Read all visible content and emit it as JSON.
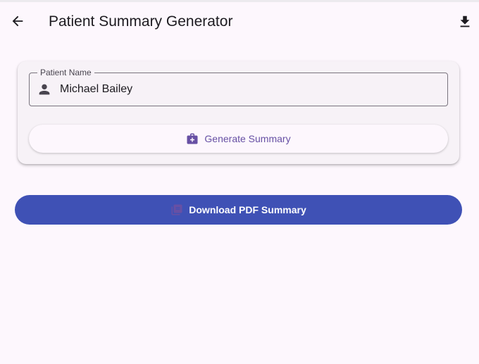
{
  "app_bar": {
    "title": "Patient Summary Generator",
    "back_icon": "arrow-back-icon",
    "action_icon": "download-icon"
  },
  "form": {
    "field_label": "Patient Name",
    "field_value": "Michael Bailey",
    "field_icon": "person-icon",
    "generate_label": "Generate Summary",
    "generate_icon": "medical-bag-icon"
  },
  "pdf_button": {
    "label": "Download PDF Summary",
    "icon": "picture-as-pdf-icon"
  },
  "colors": {
    "background": "#fdf7fd",
    "primary": "#6750a4",
    "pdf_button_bg": "#3f51b5",
    "outline": "#79747e"
  }
}
